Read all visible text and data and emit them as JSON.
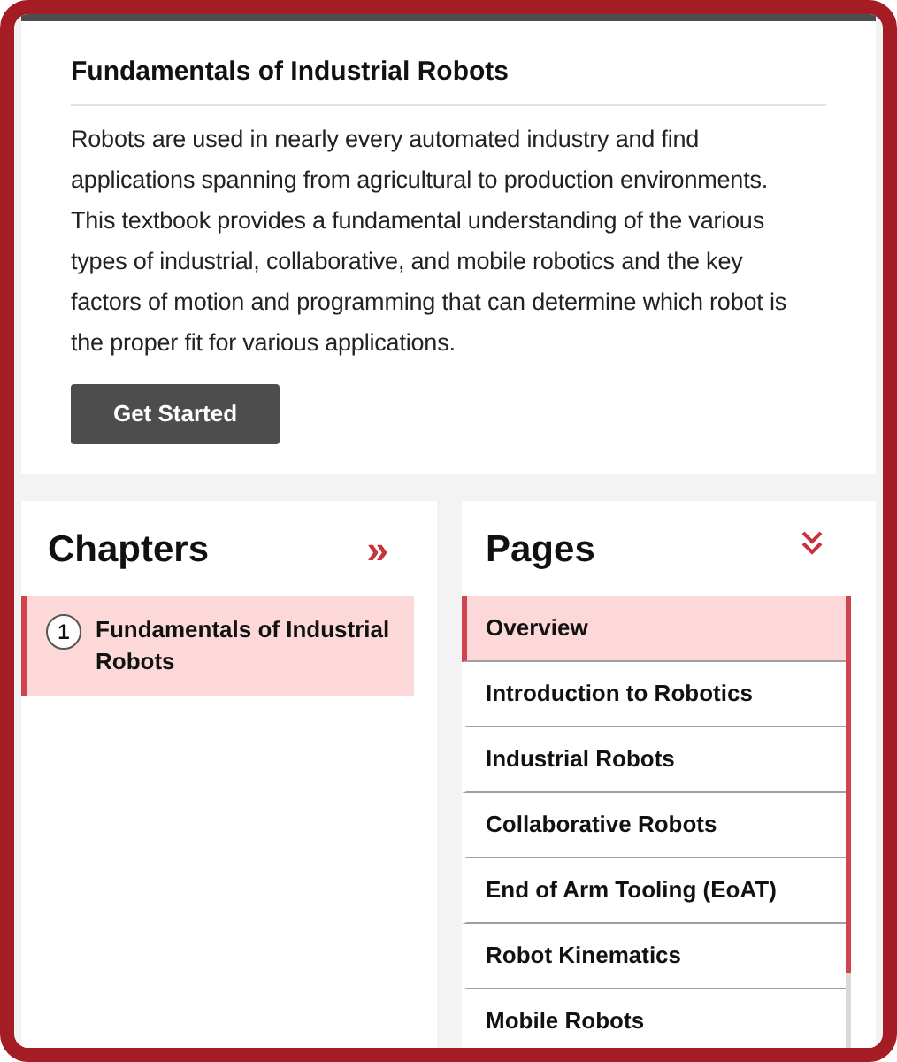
{
  "course": {
    "title": "Fundamentals of Industrial Robots",
    "description": "Robots are used in nearly every automated industry and find applications spanning from agricultural to production environments. This textbook provides a fundamental understanding of the various types of industrial, collaborative, and mobile robotics and the key factors of motion and programming that can determine which robot is the proper fit for various applications.",
    "button": "Get Started"
  },
  "chapters": {
    "heading": "Chapters",
    "toggle": "»",
    "items": [
      {
        "number": "1",
        "title": "Fundamentals of Industrial Robots",
        "selected": true
      }
    ]
  },
  "pages": {
    "heading": "Pages",
    "items": [
      {
        "title": "Overview",
        "selected": true
      },
      {
        "title": "Introduction to Robotics",
        "selected": false
      },
      {
        "title": "Industrial Robots",
        "selected": false
      },
      {
        "title": "Collaborative Robots",
        "selected": false
      },
      {
        "title": "End of Arm Tooling (EoAT)",
        "selected": false
      },
      {
        "title": "Robot Kinematics",
        "selected": false
      },
      {
        "title": "Mobile Robots",
        "selected": false
      }
    ]
  }
}
